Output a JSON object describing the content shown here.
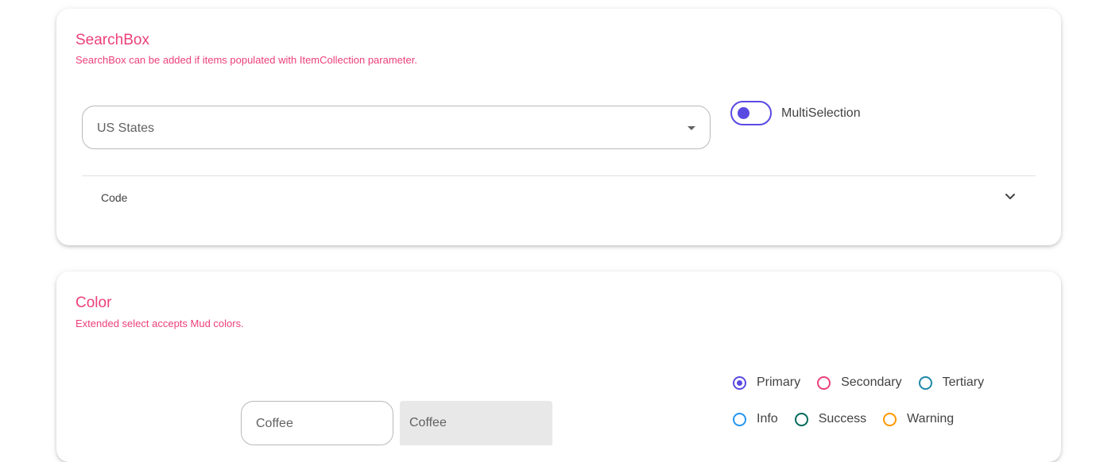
{
  "searchbox_card": {
    "title": "SearchBox",
    "subtitle": "SearchBox can be added if items populated with ItemCollection parameter.",
    "select": {
      "label": "US States"
    },
    "switch": {
      "label": "MultiSelection",
      "checked": false
    },
    "code": {
      "label": "Code"
    }
  },
  "color_card": {
    "title": "Color",
    "subtitle": "Extended select accepts Mud colors.",
    "radios_row1": [
      {
        "label": "Primary",
        "color": "#594ae2",
        "checked": true
      },
      {
        "label": "Secondary",
        "color": "#ec407a",
        "checked": false
      },
      {
        "label": "Tertiary",
        "color": "#1e88a8",
        "checked": false
      }
    ],
    "radios_row2": [
      {
        "label": "Info",
        "color": "#2196f3",
        "checked": false
      },
      {
        "label": "Success",
        "color": "#00695c",
        "checked": false
      },
      {
        "label": "Warning",
        "color": "#ff9800",
        "checked": false
      }
    ],
    "outlined_select": {
      "value": "Coffee"
    },
    "filled_select": {
      "value": "Coffee"
    }
  },
  "colors": {
    "accent": "#594ae2",
    "title": "#ec407a"
  }
}
